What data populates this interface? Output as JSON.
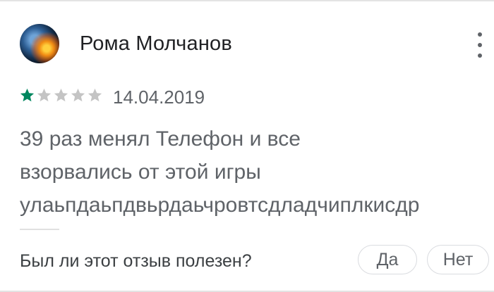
{
  "review": {
    "author": "Рома Молчанов",
    "rating": 1,
    "max_rating": 5,
    "date": "14.04.2019",
    "text": "39 раз менял Телефон и все\nвзорвались от этой игры\nулаьпдаьпдвьрдаьчровтсдладчиплкисдр"
  },
  "helpful": {
    "question": "Был ли этот отзыв полезен?",
    "yes_label": "Да",
    "no_label": "Нет"
  },
  "colors": {
    "star_filled": "#01875f",
    "star_empty": "#c4c4c4"
  }
}
